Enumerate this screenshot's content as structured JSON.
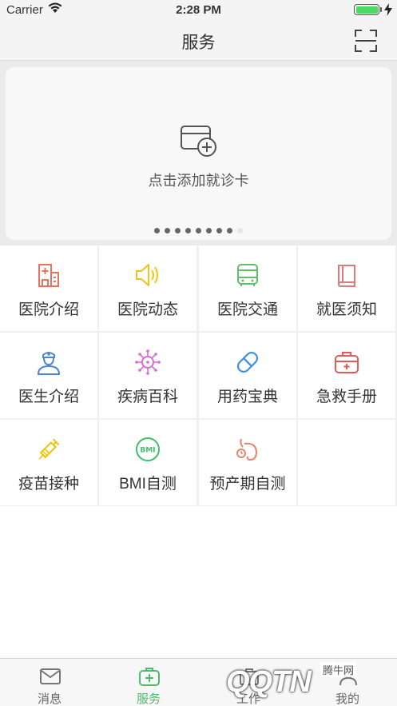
{
  "status_bar": {
    "carrier": "Carrier",
    "time": "2:28 PM"
  },
  "nav": {
    "title": "服务"
  },
  "card": {
    "label": "点击添加就诊卡",
    "page_count": 9,
    "active_index": 8
  },
  "services": [
    {
      "label": "医院介绍",
      "icon": "hospital-icon",
      "color": "#e8725e"
    },
    {
      "label": "医院动态",
      "icon": "speaker-icon",
      "color": "#f0c419"
    },
    {
      "label": "医院交通",
      "icon": "bus-icon",
      "color": "#5fbf6b"
    },
    {
      "label": "就医须知",
      "icon": "book-icon",
      "color": "#e07a7a"
    },
    {
      "label": "医生介绍",
      "icon": "doctor-icon",
      "color": "#4a86d4"
    },
    {
      "label": "疾病百科",
      "icon": "virus-icon",
      "color": "#d86bd6"
    },
    {
      "label": "用药宝典",
      "icon": "pill-icon",
      "color": "#3d8fe0"
    },
    {
      "label": "急救手册",
      "icon": "first-aid-icon",
      "color": "#e05a5a"
    },
    {
      "label": "疫苗接种",
      "icon": "syringe-icon",
      "color": "#f2c200"
    },
    {
      "label": "BMI自测",
      "icon": "bmi-icon",
      "color": "#3fbf6a"
    },
    {
      "label": "预产期自测",
      "icon": "pregnancy-icon",
      "color": "#e8836a"
    }
  ],
  "tabs": [
    {
      "label": "消息",
      "icon": "message-icon"
    },
    {
      "label": "服务",
      "icon": "medical-kit-icon",
      "active": true
    },
    {
      "label": "工作",
      "icon": "work-icon"
    },
    {
      "label": "我的",
      "icon": "user-icon"
    }
  ],
  "watermark": {
    "text": "腾牛网",
    "logo": "QQTN"
  },
  "colors": {
    "accent": "#4fba6f",
    "background": "#ebebeb"
  }
}
